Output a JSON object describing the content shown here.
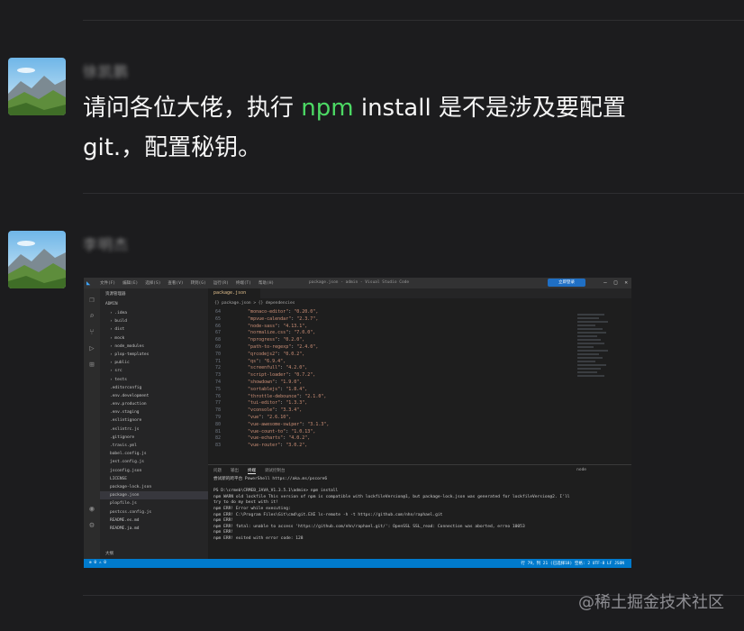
{
  "messages": [
    {
      "username": "徐凯鹏",
      "text_before": "请问各位大佬，执行 ",
      "highlight": "npm",
      "text_after": " install 是不是涉及要配置 git.，配置秘钥。"
    },
    {
      "username": "李明杰"
    }
  ],
  "watermark": "@稀土掘金技术社区",
  "vscode": {
    "title": "package.json - admin - Visual Studio Code",
    "menus": [
      "文件(F)",
      "编辑(E)",
      "选择(S)",
      "查看(V)",
      "转到(G)",
      "运行(R)",
      "终端(T)",
      "帮助(H)"
    ],
    "login_btn": "立即登录",
    "explorer_title": "资源管理器",
    "root_folder": "ADMIN",
    "files": [
      ".idea",
      "build",
      "dist",
      "mock",
      "node_modules",
      "plop-templates",
      "public",
      "src",
      "tests",
      ".editorconfig",
      ".env.development",
      ".env.production",
      ".env.staging",
      ".eslintignore",
      ".eslintrc.js",
      ".gitignore",
      ".travis.yml",
      "babel.config.js",
      "jest.config.js",
      "jsconfig.json",
      "LICENSE",
      "package-lock.json",
      "package.json",
      "plopfile.js",
      "postcss.config.js",
      "README.es.md",
      "README.ja.md"
    ],
    "selected_file": "package.json",
    "outline": "大纲",
    "tab": "package.json",
    "breadcrumb": "{} package.json > {} dependencies",
    "code": [
      {
        "n": "64",
        "k": "\"monaco-editor\"",
        "v": "\"0.20.0\","
      },
      {
        "n": "65",
        "k": "\"mpvue-calendar\"",
        "v": "\"2.3.7\","
      },
      {
        "n": "66",
        "k": "\"node-sass\"",
        "v": "\"4.13.1\","
      },
      {
        "n": "67",
        "k": "\"normalize.css\"",
        "v": "\"7.0.0\","
      },
      {
        "n": "68",
        "k": "\"nprogress\"",
        "v": "\"0.2.0\","
      },
      {
        "n": "69",
        "k": "\"path-to-regexp\"",
        "v": "\"2.4.0\","
      },
      {
        "n": "70",
        "k": "\"qrcodejs2\"",
        "v": "\"0.0.2\","
      },
      {
        "n": "71",
        "k": "\"qs\"",
        "v": "\"6.9.4\","
      },
      {
        "n": "72",
        "k": "\"screenfull\"",
        "v": "\"4.2.0\","
      },
      {
        "n": "73",
        "k": "\"script-loader\"",
        "v": "\"0.7.2\","
      },
      {
        "n": "74",
        "k": "\"showdown\"",
        "v": "\"1.9.0\","
      },
      {
        "n": "75",
        "k": "\"sortablejs\"",
        "v": "\"1.8.4\","
      },
      {
        "n": "76",
        "k": "\"throttle-debounce\"",
        "v": "\"2.1.0\","
      },
      {
        "n": "77",
        "k": "\"tui-editor\"",
        "v": "\"1.3.3\","
      },
      {
        "n": "78",
        "k": "\"vconsole\"",
        "v": "\"3.3.4\","
      },
      {
        "n": "79",
        "k": "\"vue\"",
        "v": "\"2.6.10\","
      },
      {
        "n": "80",
        "k": "\"vue-awesome-swiper\"",
        "v": "\"3.1.3\","
      },
      {
        "n": "81",
        "k": "\"vue-count-to\"",
        "v": "\"1.0.13\","
      },
      {
        "n": "82",
        "k": "\"vue-echarts\"",
        "v": "\"4.0.2\","
      },
      {
        "n": "83",
        "k": "\"vue-router\"",
        "v": "\"3.0.2\","
      }
    ],
    "term_tabs": [
      "问题",
      "输出",
      "终端",
      "调试控制台"
    ],
    "term_active": "终端",
    "term_shell": "node",
    "terminal": [
      {
        "t": "尝试新的跨平台 PowerShell https://aka.ms/pscore6",
        "c": ""
      },
      {
        "t": "",
        "c": ""
      },
      {
        "t": "PS D:\\crmeb\\CRMEB_JAVA_V1.3.5.1\\admin> npm install",
        "c": ""
      },
      {
        "t": "npm WARN old lockfile This version of npm is compatible with lockfileVersion@1, but package-lock.json was generated for lockfileVersion@2. I'll",
        "c": "warn"
      },
      {
        "t": "  try to do my best with it!",
        "c": ""
      },
      {
        "t": "npm ERR! Error while executing:",
        "c": "err"
      },
      {
        "t": "npm ERR! C:\\Program Files\\Git\\cmd\\git.EXE ls-remote -h -t https://github.com/nhn/raphael.git",
        "c": "err"
      },
      {
        "t": "npm ERR!",
        "c": "err"
      },
      {
        "t": "npm ERR! fatal: unable to access 'https://github.com/nhn/raphael.git/': OpenSSL SSL_read: Connection was aborted, errno 10053",
        "c": "err"
      },
      {
        "t": "npm ERR!",
        "c": "err"
      },
      {
        "t": "npm ERR! exited with error code: 128",
        "c": "err"
      }
    ],
    "status_left": "⊗ 0 ⚠ 0",
    "status_right": "行 79，列 21 (已选择18)   空格: 2   UTF-8   LF   JSON"
  }
}
